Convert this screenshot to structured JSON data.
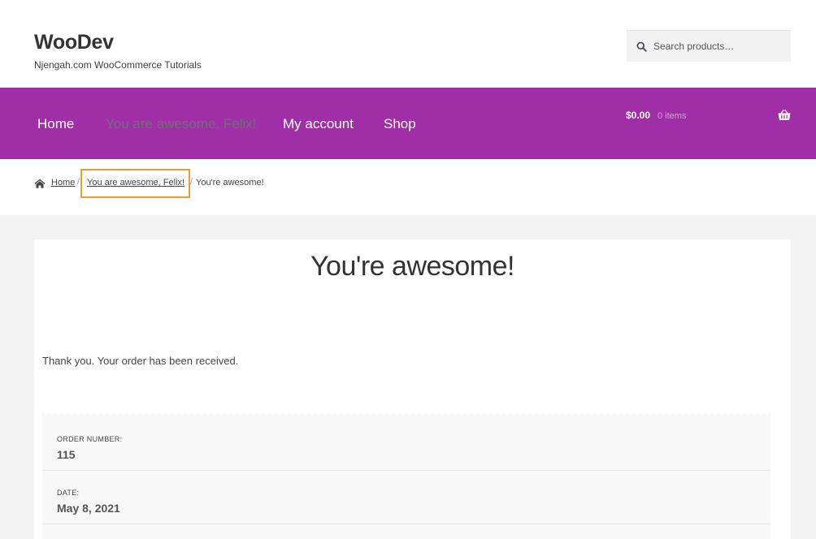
{
  "header": {
    "site_title": "WooDev",
    "site_description": "Njengah.com WooCommerce Tutorials",
    "search_placeholder": "Search products…"
  },
  "nav": {
    "items": [
      {
        "label": "Home"
      },
      {
        "label": "You are awesome, Felix!",
        "active": true
      },
      {
        "label": "My account"
      },
      {
        "label": "Shop"
      }
    ],
    "cart_amount": "$0.00",
    "cart_count": "0 items"
  },
  "breadcrumb": {
    "home": "Home",
    "parent": "You are awesome, Felix!",
    "current": "You're awesome!",
    "separator": "/"
  },
  "main": {
    "page_title": "You're awesome!",
    "thank_you": "Thank you. Your order has been received.",
    "order_details": [
      {
        "label": "ORDER NUMBER:",
        "value": "115"
      },
      {
        "label": "DATE:",
        "value": "May 8, 2021"
      }
    ]
  },
  "colors": {
    "nav_background": "#a02ea6",
    "highlight_border": "#f29a33",
    "active_nav_text": "#6e7172"
  },
  "icons": {
    "search": "search-icon",
    "cart": "basket-icon",
    "home": "home-icon"
  }
}
